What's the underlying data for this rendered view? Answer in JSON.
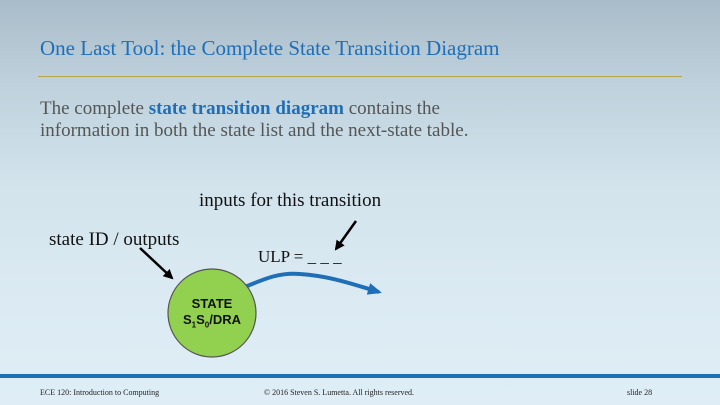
{
  "slide": {
    "title": "One Last Tool: the Complete State Transition Diagram",
    "body_pre": "The complete ",
    "body_highlight": "state transition diagram",
    "body_post": " contains the information in both the state list and the next-state table."
  },
  "diagram": {
    "inputs_label": "inputs for this transition",
    "state_label": "state ID / outputs",
    "ulp_label": "ULP = _ _ _",
    "state_name": "STATE",
    "state_s": "S",
    "state_sub1": "1",
    "state_sub0": "0",
    "state_outputs": "/DRA",
    "colors": {
      "state_fill": "#92d050",
      "transition_arrow": "#1f6fb8",
      "pointer_arrows": "#000000"
    }
  },
  "footer": {
    "course": "ECE 120: Introduction to Computing",
    "copyright": "© 2016 Steven S. Lumetta.  All rights reserved.",
    "slide_number": "slide 28"
  }
}
